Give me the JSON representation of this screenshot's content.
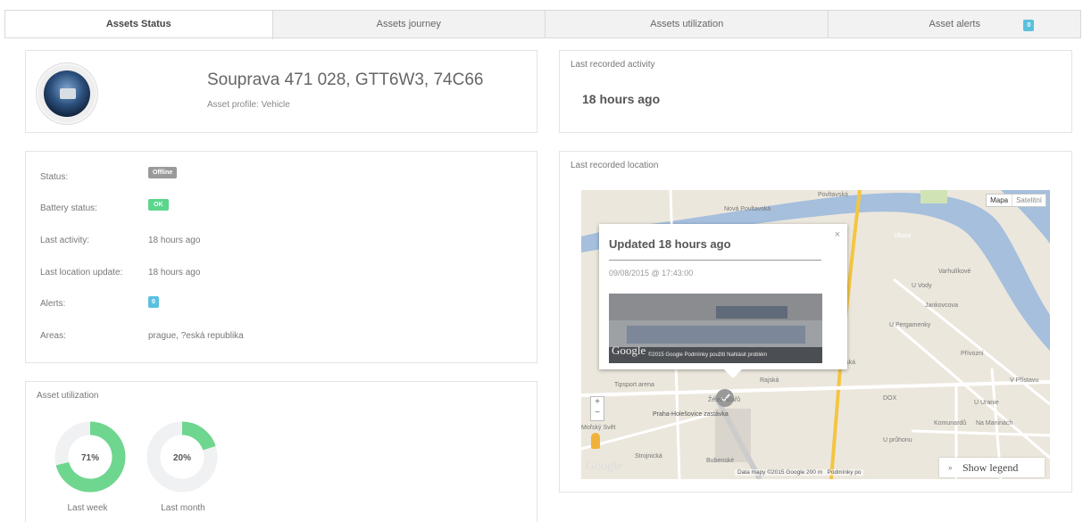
{
  "top_strip": {
    "title": "",
    "right": ""
  },
  "tabs": [
    {
      "label": "Assets Status",
      "active": true
    },
    {
      "label": "Assets journey",
      "active": false
    },
    {
      "label": "Assets utilization",
      "active": false
    },
    {
      "label": "Asset alerts",
      "active": false,
      "badge": "0"
    }
  ],
  "profile": {
    "name": "Souprava 471 028, GTT6W3, 74C66",
    "asset_profile": "Asset profile: Vehicle"
  },
  "activity": {
    "title": "Last recorded activity",
    "value": "18 hours ago"
  },
  "status": {
    "rows": [
      {
        "label": "Status:",
        "badge": "Offline",
        "badge_color": "#9a9a9a"
      },
      {
        "label": "Battery status:",
        "badge": "OK",
        "badge_color": "#5cd68c"
      },
      {
        "label": "Last activity:",
        "value": "18 hours ago"
      },
      {
        "label": "Last location update:",
        "value": "18 hours ago"
      },
      {
        "label": "Alerts:",
        "badge": "0",
        "badge_color": "#5bc0de"
      },
      {
        "label": "Areas:",
        "value": "prague, ?eská republika"
      }
    ]
  },
  "utilization": {
    "title": "Asset utilization",
    "charts": [
      {
        "label": "Last week",
        "value_text": "71%",
        "value": 0.71
      },
      {
        "label": "Last month",
        "value_text": "20%",
        "value": 0.2
      }
    ],
    "colors": {
      "fill": "#6fd68f",
      "track": "#f0f1f3"
    }
  },
  "location": {
    "title": "Last recorded location",
    "map_buttons": {
      "map": "Mapa",
      "satellite": "Satelitní"
    },
    "popup": {
      "title": "Updated 18 hours ago",
      "date": "09/08/2015 @ 17:43:00",
      "close": "×",
      "photo_attribution": "©2015 Google   Podmínky použití   Nahlásit problém",
      "photo_logo": "Google"
    },
    "labels": {
      "povltavska": "Povltavská",
      "nova_povltavska": "Nová Povltavská",
      "vltava": "Vltava",
      "varhulikove": "Varhulíkové",
      "jankovcova": "Jankovcova",
      "upergamenky": "U Pergamenky",
      "privozni": "Přívozní",
      "tipsport": "Tipsport arena",
      "praha_holesovice": "Praha-Holešovice zastávka",
      "argentinska": "Argentinská",
      "dox": "DOX",
      "upruhonu": "U průhonu",
      "molsky_svet": "Mořský Svět",
      "stropnicka": "Strojnická",
      "u_vody": "U Vody",
      "rajska": "Rajská",
      "v_pristavu": "V Přístavu",
      "u_uranie": "U Uranie",
      "komunardu": "Komunardů",
      "na_manine": "Na Maninách",
      "zeleznicaru": "Železničářů",
      "bubenske": "Bubenské"
    },
    "attribution": "Data mapy ©2015 Google   200 m",
    "attribution_right": "Podmínky po",
    "google_logo": "Google",
    "zoom_in": "+",
    "zoom_out": "−",
    "legend_button": "Show legend",
    "legend_chevron": "»"
  }
}
